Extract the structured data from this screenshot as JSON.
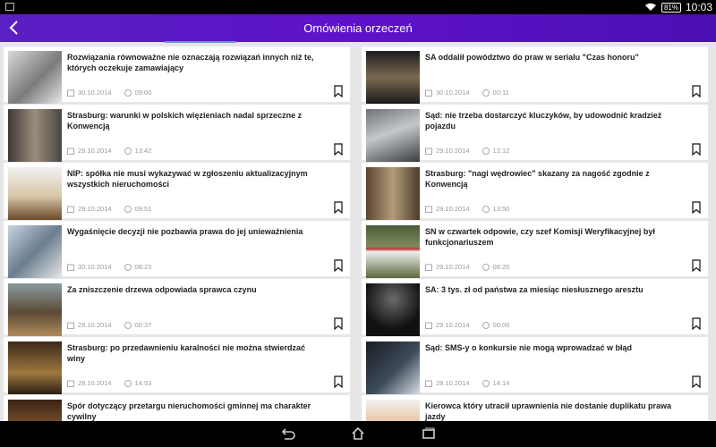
{
  "status": {
    "battery": "81%",
    "time": "10:03"
  },
  "appbar": {
    "title": "Omówienia orzeczeń"
  },
  "icons": {
    "date": "calendar-icon",
    "time": "clock-icon",
    "bookmark": "bookmark-icon"
  },
  "articles": [
    {
      "title": "Rozwiązania równoważne nie oznaczają rozwiązań innych niż te, których oczekuje zamawiający",
      "date": "30.10.2014",
      "time": "09:00"
    },
    {
      "title": "SA oddalił powództwo do praw w serialu \"Czas honoru\"",
      "date": "30.10.2014",
      "time": "00:11"
    },
    {
      "title": "Strasburg: warunki w polskich więzieniach nadal sprzeczne z Konwencją",
      "date": "29.10.2014",
      "time": "13:42"
    },
    {
      "title": "Sąd: nie trzeba dostarczyć kluczyków, by udowodnić kradzież pojazdu",
      "date": "29.10.2014",
      "time": "12:12"
    },
    {
      "title": "NIP: spółka nie musi wykazywać w zgłoszeniu aktualizacyjnym wszystkich nieruchomości",
      "date": "29.10.2014",
      "time": "09:51"
    },
    {
      "title": "Strasburg: \"nagi wędrowiec\" skazany za nagość zgodnie z Konwencją",
      "date": "29.10.2014",
      "time": "13:50"
    },
    {
      "title": "Wygaśnięcie decyzji nie pozbawia prawa do jej unieważnienia",
      "date": "30.10.2014",
      "time": "08:23"
    },
    {
      "title": "SN w czwartek odpowie, czy szef Komisji Weryfikacyjnej był funkcjonariuszem",
      "date": "29.10.2014",
      "time": "08:20"
    },
    {
      "title": "Za zniszczenie drzewa odpowiada sprawca czynu",
      "date": "29.10.2014",
      "time": "00:37"
    },
    {
      "title": "SA: 3 tys. zł od państwa za miesiąc niesłusznego aresztu",
      "date": "29.10.2014",
      "time": "00:06"
    },
    {
      "title": "Strasburg: po przedawnieniu karalności nie można stwierdzać winy",
      "date": "28.10.2014",
      "time": "14:53"
    },
    {
      "title": "Sąd: SMS-y o konkursie nie mogą wprowadzać w błąd",
      "date": "28.10.2014",
      "time": "14:14"
    },
    {
      "title": "Spór dotyczący przetargu nieruchomości gminnej ma charakter cywilny",
      "date": "",
      "time": ""
    },
    {
      "title": "Kierowca który utracił uprawnienia nie dostanie duplikatu prawa jazdy",
      "date": "",
      "time": ""
    }
  ]
}
